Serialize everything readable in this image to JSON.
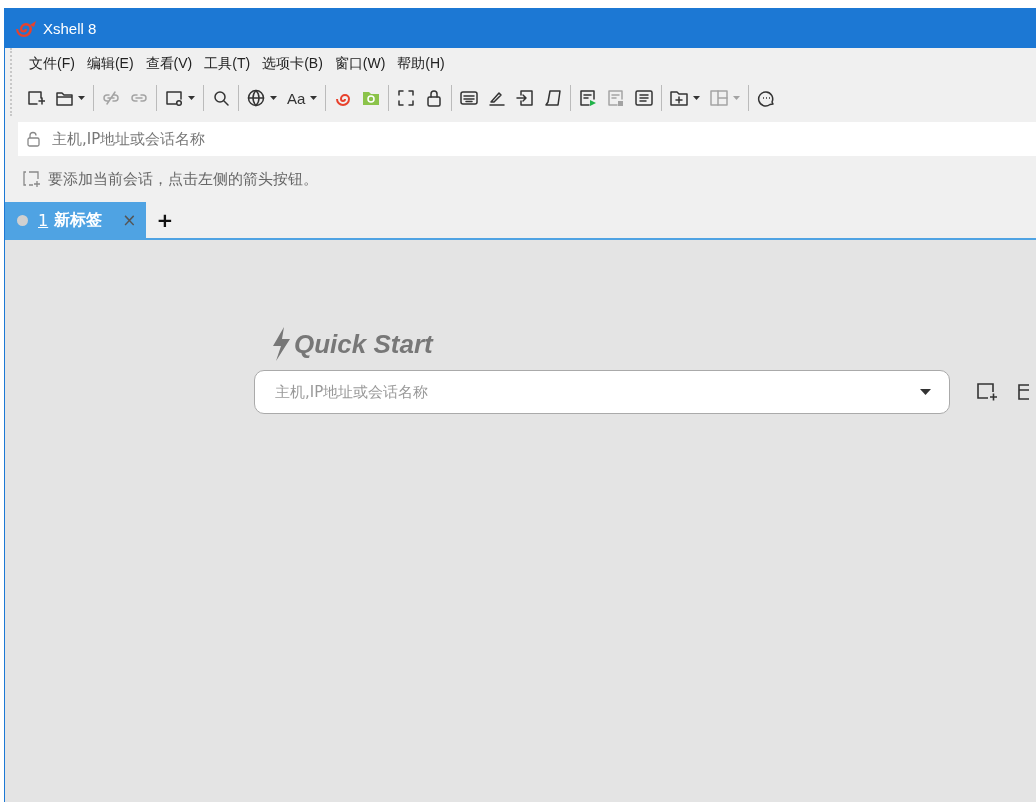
{
  "window": {
    "title": "Xshell 8"
  },
  "menu": [
    "文件(F)",
    "编辑(E)",
    "查看(V)",
    "工具(T)",
    "选项卡(B)",
    "窗口(W)",
    "帮助(H)"
  ],
  "toolbar": [
    [
      {
        "disabled": false,
        "dropdown": false
      },
      {
        "disabled": false,
        "dropdown": true
      }
    ],
    [
      {
        "disabled": true,
        "dropdown": false
      },
      {
        "disabled": true,
        "dropdown": false
      }
    ],
    [
      {
        "disabled": false,
        "dropdown": true
      }
    ],
    [
      {
        "disabled": false,
        "dropdown": false
      }
    ],
    [
      {
        "disabled": false,
        "dropdown": true
      },
      {
        "disabled": false,
        "dropdown": true,
        "label": "Aa"
      }
    ],
    [
      {
        "disabled": false,
        "dropdown": false
      },
      {
        "disabled": false,
        "dropdown": false
      }
    ],
    [
      {
        "disabled": false,
        "dropdown": false
      },
      {
        "disabled": false,
        "dropdown": false
      }
    ],
    [
      {
        "disabled": false,
        "dropdown": false
      },
      {
        "disabled": false,
        "dropdown": false
      },
      {
        "disabled": false,
        "dropdown": false
      },
      {
        "disabled": false,
        "dropdown": false
      }
    ],
    [
      {
        "disabled": false,
        "dropdown": false
      },
      {
        "disabled": true,
        "dropdown": false
      },
      {
        "disabled": false,
        "dropdown": false
      }
    ],
    [
      {
        "disabled": false,
        "dropdown": true
      },
      {
        "disabled": true,
        "dropdown": true
      }
    ],
    [
      {
        "disabled": false,
        "dropdown": false
      }
    ]
  ],
  "address_bar": {
    "placeholder": "主机,IP地址或会话名称"
  },
  "hint": "要添加当前会话，点击左侧的箭头按钮。",
  "tabs": [
    {
      "number": "1",
      "label": "新标签",
      "selected": true,
      "connected": false,
      "close": "×"
    }
  ],
  "new_tab": "+",
  "quick_start": {
    "title": "Quick Start",
    "placeholder": "主机,IP地址或会话名称"
  }
}
